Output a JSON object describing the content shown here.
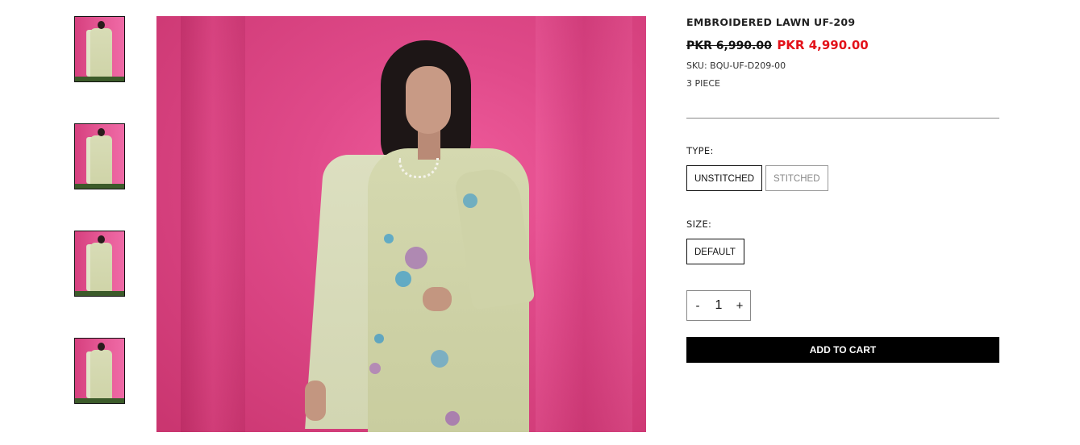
{
  "gallery": {
    "thumbnails": [
      {
        "alt": "product thumbnail 1"
      },
      {
        "alt": "product thumbnail 2"
      },
      {
        "alt": "product thumbnail 3"
      },
      {
        "alt": "product thumbnail 4"
      }
    ]
  },
  "product": {
    "title": "EMBROIDERED LAWN UF-209",
    "price_old": "PKR 6,990.00",
    "price_new": "PKR 4,990.00",
    "sku": "SKU: BQU-UF-D209-00",
    "pieces": "3 PIECE",
    "sale_color": "#e3121a"
  },
  "options": {
    "type_label": "TYPE:",
    "type_values": [
      "UNSTITCHED",
      "STITCHED"
    ],
    "type_selected": "UNSTITCHED",
    "size_label": "SIZE:",
    "size_values": [
      "DEFAULT"
    ],
    "size_selected": "DEFAULT"
  },
  "quantity": {
    "minus": "-",
    "value": "1",
    "plus": "+"
  },
  "cart": {
    "add_label": "ADD TO CART"
  }
}
